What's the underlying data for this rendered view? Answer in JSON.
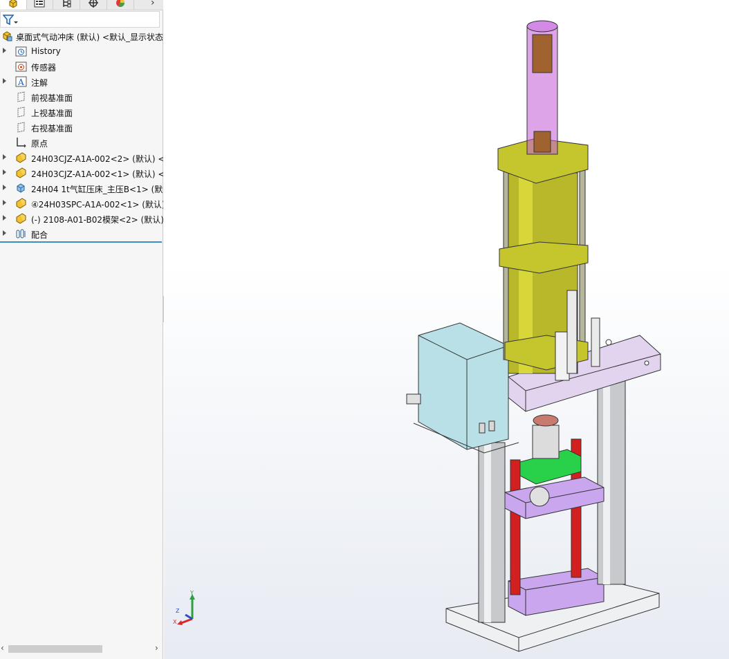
{
  "tabs": [
    {
      "icon": "feature-manager-icon"
    },
    {
      "icon": "property-manager-icon"
    },
    {
      "icon": "configuration-manager-icon"
    },
    {
      "icon": "dimxpert-icon"
    },
    {
      "icon": "display-manager-icon"
    }
  ],
  "tabs_more_glyph": "›",
  "filter_icon": "filter-icon",
  "tree": {
    "root": {
      "label": "桌面式气动冲床 (默认) <默认_显示状态-",
      "icon": "assembly-icon"
    },
    "items": [
      {
        "label": "History",
        "icon": "history-icon",
        "expandable": true
      },
      {
        "label": "传感器",
        "icon": "sensor-icon",
        "expandable": false
      },
      {
        "label": "注解",
        "icon": "annotation-icon",
        "expandable": true
      },
      {
        "label": "前视基准面",
        "icon": "plane-icon",
        "expandable": false
      },
      {
        "label": "上视基准面",
        "icon": "plane-icon",
        "expandable": false
      },
      {
        "label": "右视基准面",
        "icon": "plane-icon",
        "expandable": false
      },
      {
        "label": "原点",
        "icon": "origin-icon",
        "expandable": false
      },
      {
        "label": "24H03CJZ-A1A-002<2> (默认) <<",
        "icon": "subassembly-icon",
        "expandable": true
      },
      {
        "label": "24H03CJZ-A1A-002<1> (默认) <<",
        "icon": "subassembly-icon",
        "expandable": true
      },
      {
        "label": "24H04 1t气缸压床_主压B<1> (默认",
        "icon": "part-icon",
        "expandable": true
      },
      {
        "label": "④24H03SPC-A1A-002<1> (默认)",
        "icon": "subassembly-icon",
        "expandable": true
      },
      {
        "label": "(-) 2108-A01-B02模架<2> (默认)",
        "icon": "subassembly-icon",
        "expandable": true
      },
      {
        "label": "配合",
        "icon": "mates-icon",
        "expandable": true
      }
    ]
  },
  "triad": {
    "x": "X",
    "y": "Y",
    "z": "Z"
  },
  "colors": {
    "accent": "#3a8fc1",
    "x_axis": "#d9262b",
    "y_axis": "#2ea043",
    "z_axis": "#2b4fc7"
  }
}
